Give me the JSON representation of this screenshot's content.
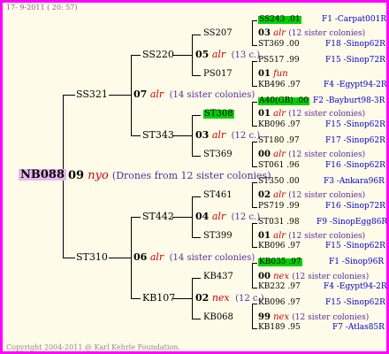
{
  "header": {
    "date": "17- 9-2011 ( 20: 57)"
  },
  "footer": {
    "copyright": "Copyright 2004-2011 @ Karl Kehrle Foundation."
  },
  "root": {
    "id": "NB088",
    "num": "09",
    "marker": "nyo",
    "note": "(Drones from 12 sister colonies)"
  },
  "gen1": {
    "top": {
      "id": "SS321",
      "num": "07",
      "marker": "alr",
      "note": "(14 sister colonies)"
    },
    "bottom": {
      "id": "ST310",
      "num": "06",
      "marker": "alr",
      "note": "(14 sister colonies)"
    }
  },
  "gen2": [
    {
      "id": "SS220",
      "num": "05",
      "marker": "alr",
      "note": "(13 c.)"
    },
    {
      "id": "ST343",
      "num": "03",
      "marker": "alr",
      "note": "(12 c.)"
    },
    {
      "id": "ST442",
      "num": "04",
      "marker": "alr",
      "note": "(12 c.)"
    },
    {
      "id": "KB107",
      "num": "02",
      "marker": "nex",
      "note": "(12 c.)"
    }
  ],
  "gen3": [
    {
      "id": "SS207",
      "num": "03",
      "marker": "alr",
      "note": "(12 sister colonies)"
    },
    {
      "id": "PS017",
      "num": "01",
      "marker": "fun",
      "note": ""
    },
    {
      "id": "ST308",
      "num": "01",
      "marker": "alr",
      "note": "(12 sister colonies)"
    },
    {
      "id": "ST369",
      "num": "00",
      "marker": "alr",
      "note": "(12 sister colonies)"
    },
    {
      "id": "ST461",
      "num": "02",
      "marker": "alr",
      "note": "(12 sister colonies)"
    },
    {
      "id": "ST399",
      "num": "01",
      "marker": "alr",
      "note": "(12 sister colonies)"
    },
    {
      "id": "KB437",
      "num": "00",
      "marker": "nex",
      "note": "(12 sister colonies)"
    },
    {
      "id": "KB068",
      "num": "99",
      "marker": "nex",
      "note": "(12 sister colonies)"
    }
  ],
  "gen4": [
    {
      "id": "SS243",
      "val": ".01",
      "label": "F1 -Carpat001R"
    },
    {
      "id": "ST369",
      "val": ".00",
      "label": "F18 -Sinop62R"
    },
    {
      "id": "PS517",
      "val": ".99",
      "label": "F15 -Sinop72R"
    },
    {
      "id": "KB496",
      "val": ".97",
      "label": "F4 -Egypt94-2R"
    },
    {
      "id": "A40(GB)",
      "val": ".00",
      "label": "F2 -Bayburt98-3R"
    },
    {
      "id": "KB096",
      "val": ".97",
      "label": "F15 -Sinop62R"
    },
    {
      "id": "ST180",
      "val": ".97",
      "label": "F17 -Sinop62R"
    },
    {
      "id": "ST061",
      "val": ".96",
      "label": "F16 -Sinop62R"
    },
    {
      "id": "ST350",
      "val": ".00",
      "label": "F3 -Ankara96R"
    },
    {
      "id": "PS719",
      "val": ".99",
      "label": "F16 -Sinop72R"
    },
    {
      "id": "ST031",
      "val": ".98",
      "label": "F9 -SinopEgg86R"
    },
    {
      "id": "KB096",
      "val": ".97",
      "label": "F15 -Sinop62R"
    },
    {
      "id": "KB035",
      "val": ".97",
      "label": "F1 -Sinop96R"
    },
    {
      "id": "KB232",
      "val": ".97",
      "label": "F4 -Egypt94-2R"
    },
    {
      "id": "KB096",
      "val": ".97",
      "label": "F15 -Sinop62R"
    },
    {
      "id": "KB189",
      "val": ".95",
      "label": "F7 -Atlas85R"
    }
  ]
}
